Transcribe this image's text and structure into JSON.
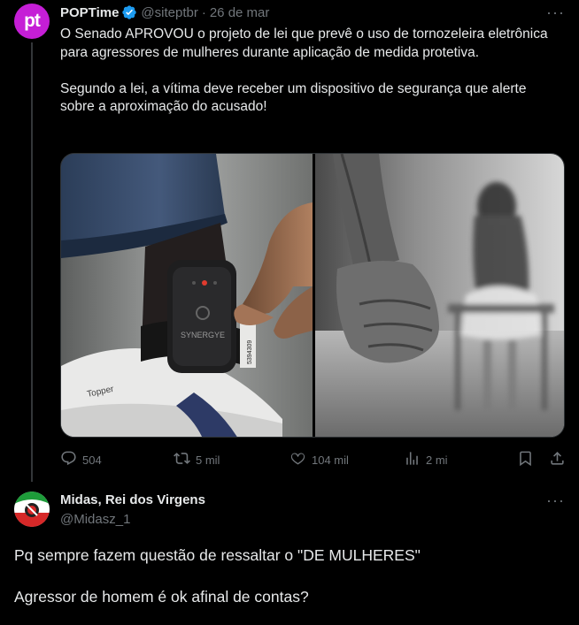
{
  "tweet": {
    "avatar_text": "pt",
    "author_name": "POPTime",
    "handle": "@siteptbr",
    "separator": "·",
    "date": "26 de mar",
    "paragraph1": "O Senado APROVOU o projeto de lei que prevê o uso de tornozeleira eletrônica para agressores de mulheres durante aplicação de medida protetiva.",
    "paragraph2": "Segundo a lei, a vítima deve receber um dispositivo de segurança que alerte sobre a aproximação do acusado!",
    "image_left_texts": {
      "device_brand": "SYNERGYE",
      "serial": "5394309",
      "shoe_brand": "Topper"
    },
    "stats": {
      "replies": "504",
      "reposts": "5 mil",
      "likes": "104 mil",
      "views": "2 mi"
    }
  },
  "reply": {
    "author_name": "Midas, Rei dos Virgens",
    "handle": "@Midasz_1",
    "line1": "Pq sempre fazem questão de ressaltar o \"DE MULHERES\"",
    "line2": "Agressor de homem é ok afinal de contas?"
  },
  "colors": {
    "background": "#000000",
    "text": "#e7e9ea",
    "muted": "#71767b",
    "avatar": "#c51ed6",
    "verified": "#1d9bf0"
  }
}
